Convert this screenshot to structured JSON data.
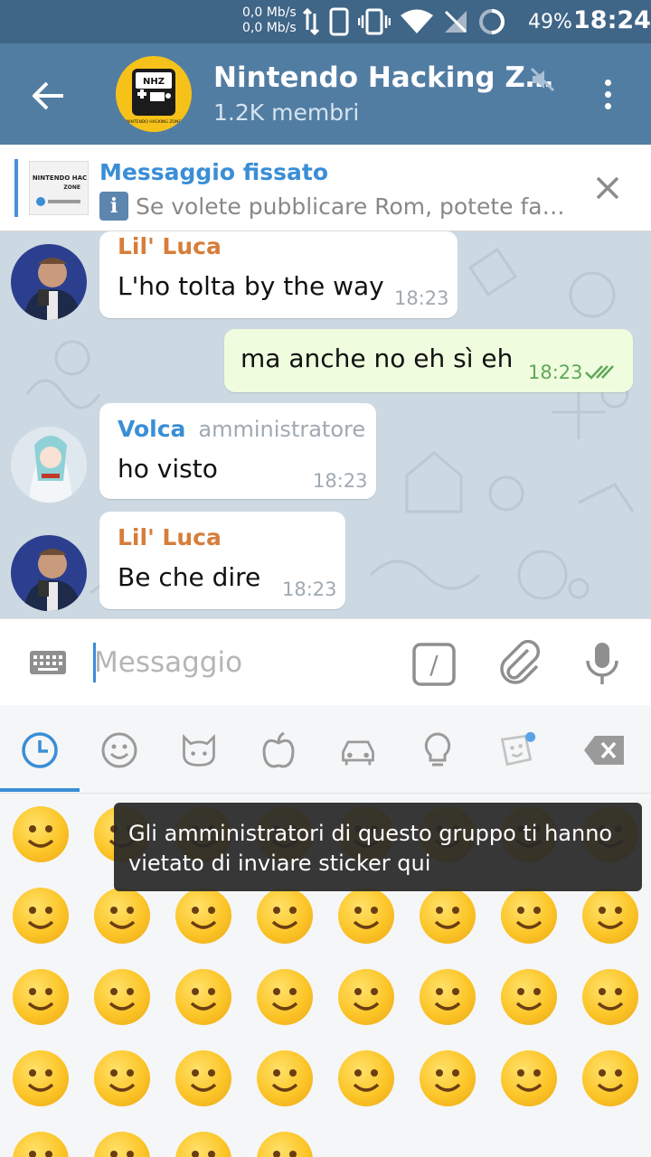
{
  "status_bar": {
    "net_speed_up": "0,0 Mb/s",
    "net_speed_down": "0,0 Mb/s",
    "battery": "49%",
    "time": "18:24",
    "icons": [
      "data-arrows-icon",
      "phone-outline-icon",
      "vibrate-icon",
      "wifi-icon",
      "no-signal-icon",
      "battery-ring-icon"
    ]
  },
  "header": {
    "title": "Nintendo Hacking Z…",
    "subtitle": "1.2K membri",
    "avatar_text": "NHZ",
    "avatar_caption": "NINTENDO HACKING ZONE",
    "accent": "#527da3"
  },
  "pinned": {
    "title": "Messaggio fissato",
    "text": "Se volete pubblicare Rom, potete fa…",
    "info_glyph": "i",
    "thumb_text": "NINTENDO HAC",
    "thumb_text2": "ZONE"
  },
  "messages": [
    {
      "sender": "Lil' Luca",
      "role": "",
      "text": "L'ho tolta by the way",
      "time": "18:23",
      "outgoing": false
    },
    {
      "sender": "",
      "role": "",
      "text": "ma anche no eh sì eh",
      "time": "18:23",
      "outgoing": true
    },
    {
      "sender": "Volca",
      "role": "amministratore",
      "text": "ho visto",
      "time": "18:23",
      "outgoing": false
    },
    {
      "sender": "Lil' Luca",
      "role": "",
      "text": "Be che dire",
      "time": "18:23",
      "outgoing": false
    }
  ],
  "input": {
    "placeholder": "Messaggio",
    "cmd_glyph": "/"
  },
  "emoji_tabs": [
    "recent-clock-icon",
    "smiley-icon",
    "cat-icon",
    "apple-icon",
    "car-icon",
    "lightbulb-icon",
    "sticker-icon",
    "backspace-icon"
  ],
  "toast": {
    "line1": "Gli amministratori di questo gruppo ti hanno",
    "line2": "vietato di inviare sticker qui"
  },
  "emojis": [
    "😂",
    "😘",
    "❤️",
    "😍",
    "😊",
    "😁",
    "👍",
    "☺️",
    "😔",
    "😄",
    "😭",
    "💋",
    "😒",
    "😳",
    "😜",
    "🙈",
    "😉",
    "😃",
    "😢",
    "😝",
    "😱",
    "😡",
    "😏",
    "😞",
    "😅",
    "😚",
    "🙊",
    "😌",
    "😀",
    "😋",
    "😆",
    "👌",
    "😐",
    "😕",
    "😟",
    "☮️"
  ],
  "colors": {
    "name_luca": "#d67e3a",
    "name_volca": "#3a8ed6",
    "tab_active": "#3a8ed6"
  }
}
